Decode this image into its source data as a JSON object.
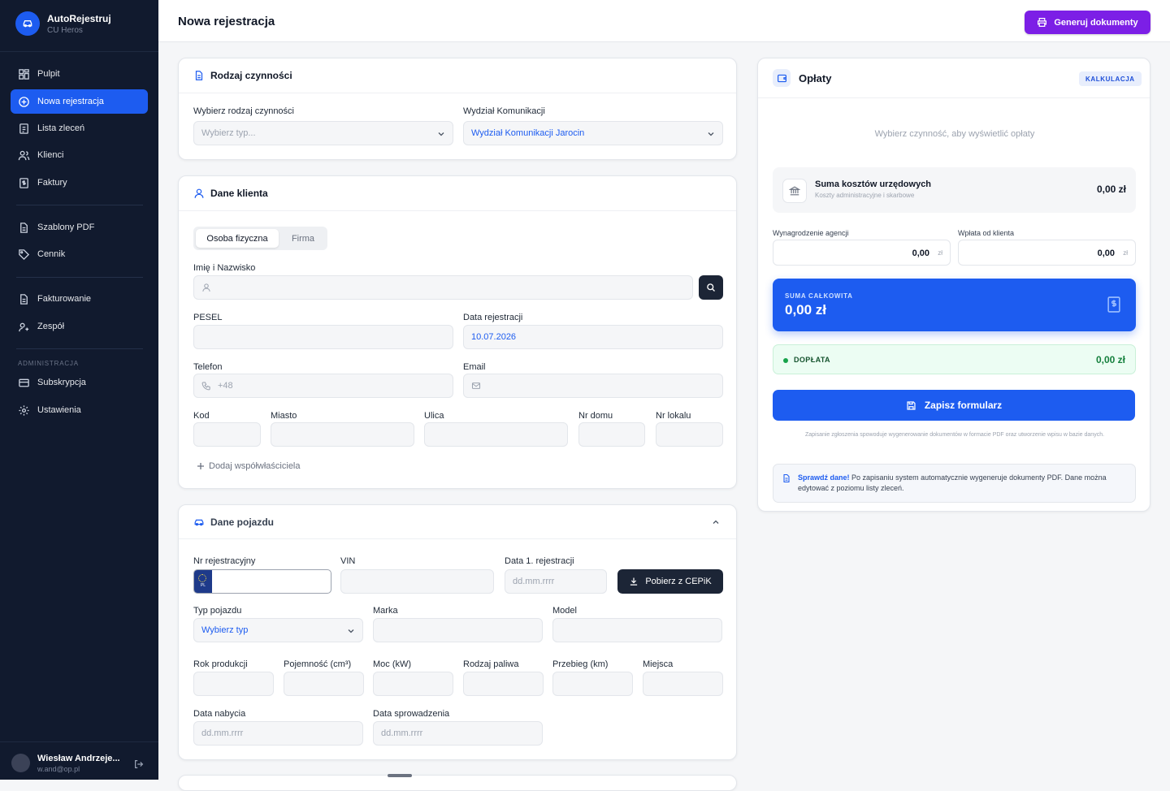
{
  "app": {
    "name": "AutoRejestruj",
    "subtitle": "CU Heros"
  },
  "sidebar": {
    "items": [
      {
        "label": "Pulpit",
        "icon": "dashboard-icon"
      },
      {
        "label": "Nowa rejestracja",
        "icon": "plus-circle-icon",
        "active": true
      },
      {
        "label": "Lista zleceń",
        "icon": "list-icon"
      },
      {
        "label": "Klienci",
        "icon": "users-icon"
      },
      {
        "label": "Faktury",
        "icon": "invoice-icon"
      },
      {
        "label": "Szablony PDF",
        "icon": "file-icon"
      },
      {
        "label": "Cennik",
        "icon": "tag-icon"
      },
      {
        "label": "Fakturowanie",
        "icon": "file-icon"
      },
      {
        "label": "Zespół",
        "icon": "team-icon"
      }
    ],
    "admin_section": "ADMINISTRACJA",
    "admin_items": [
      {
        "label": "Subskrypcja",
        "icon": "card-icon"
      },
      {
        "label": "Ustawienia",
        "icon": "gear-icon"
      }
    ],
    "user": {
      "name": "Wiesław Andrzeje...",
      "email": "w.and@op.pl"
    }
  },
  "header": {
    "title": "Nowa rejestracja",
    "generate_label": "Generuj dokumenty"
  },
  "activity": {
    "title": "Rodzaj czynności",
    "type_label": "Wybierz rodzaj czynności",
    "type_placeholder": "Wybierz typ...",
    "office_label": "Wydział Komunikacji",
    "office_value": "Wydział Komunikacji Jarocin"
  },
  "client": {
    "title": "Dane klienta",
    "tab_person": "Osoba fizyczna",
    "tab_company": "Firma",
    "name_label": "Imię i Nazwisko",
    "pesel_label": "PESEL",
    "reg_date_label": "Data rejestracji",
    "reg_date_value": "10.07.2026",
    "phone_label": "Telefon",
    "phone_placeholder": "+48",
    "email_label": "Email",
    "code_label": "Kod",
    "city_label": "Miasto",
    "street_label": "Ulica",
    "house_label": "Nr domu",
    "flat_label": "Nr lokalu",
    "add_coowner": "Dodaj współwłaściciela"
  },
  "vehicle": {
    "title": "Dane pojazdu",
    "reg_no_label": "Nr rejestracyjny",
    "plate_country": "PL",
    "vin_label": "VIN",
    "first_reg_label": "Data 1. rejestracji",
    "date_placeholder": "dd.mm.rrrr",
    "cepik_label": "Pobierz z CEPiK",
    "type_label": "Typ pojazdu",
    "type_value": "Wybierz typ",
    "brand_label": "Marka",
    "model_label": "Model",
    "year_label": "Rok produkcji",
    "capacity_label": "Pojemność (cm³)",
    "power_label": "Moc (kW)",
    "fuel_label": "Rodzaj paliwa",
    "mileage_label": "Przebieg (km)",
    "seats_label": "Miejsca",
    "acquired_label": "Data nabycia",
    "import_label": "Data sprowadzenia"
  },
  "fees": {
    "title": "Opłaty",
    "badge": "KALKULACJA",
    "empty_text": "Wybierz czynność, aby wyświetlić opłaty",
    "official_title": "Suma kosztów urzędowych",
    "official_sub": "Koszty administracyjne i skarbowe",
    "official_value": "0,00 zł",
    "agency_label": "Wynagrodzenie agencji",
    "agency_value": "0,00",
    "client_pay_label": "Wpłata od klienta",
    "client_pay_value": "0,00",
    "currency": "zł",
    "total_label": "SUMA CAŁKOWITA",
    "total_value": "0,00 zł",
    "extra_label": "DOPŁATA",
    "extra_value": "0,00 zł",
    "save_label": "Zapisz formularz",
    "save_note": "Zapisanie zgłoszenia spowoduje wygenerowanie dokumentów w formacie PDF oraz utworzenie wpisu w bazie danych.",
    "info_bold": "Sprawdź dane!",
    "info_text": "Po zapisaniu system automatycznie wygeneruje dokumenty PDF. Dane można edytować z poziomu listy zleceń."
  },
  "colors": {
    "accent": "#1d5cf0",
    "sidebar": "#111a2e",
    "generate": "#7c1fe6",
    "success": "#16a34a"
  }
}
